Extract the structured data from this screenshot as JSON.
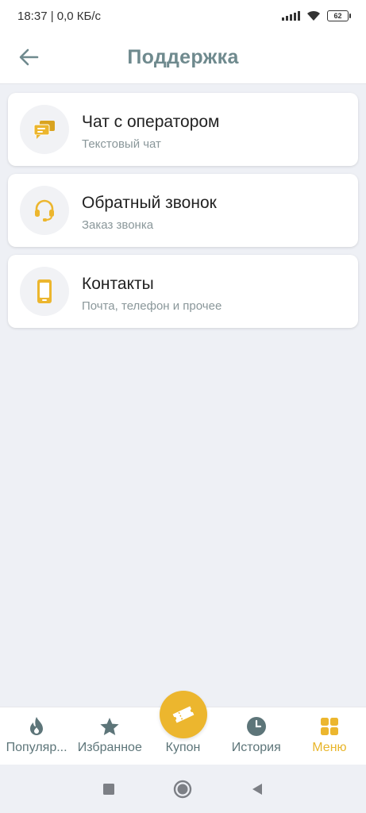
{
  "status_bar": {
    "time_speed": "18:37 | 0,0 КБ/с",
    "battery": "62"
  },
  "header": {
    "title": "Поддержка"
  },
  "colors": {
    "accent": "#ecb62e",
    "title": "#6f8a8e",
    "nav_inactive": "#5d7579",
    "background": "#eef0f5"
  },
  "items": [
    {
      "title": "Чат с оператором",
      "subtitle": "Текстовый чат",
      "icon": "chat-bubbles-icon"
    },
    {
      "title": "Обратный звонок",
      "subtitle": "Заказ звонка",
      "icon": "headset-icon"
    },
    {
      "title": "Контакты",
      "subtitle": "Почта, телефон и прочее",
      "icon": "phone-device-icon"
    }
  ],
  "bottom_nav": [
    {
      "label": "Популяр...",
      "icon": "flame-icon",
      "active": false
    },
    {
      "label": "Избранное",
      "icon": "star-icon",
      "active": false
    },
    {
      "label": "Купон",
      "icon": "ticket-icon",
      "active": false
    },
    {
      "label": "История",
      "icon": "clock-icon",
      "active": false
    },
    {
      "label": "Меню",
      "icon": "grid-icon",
      "active": true
    }
  ]
}
